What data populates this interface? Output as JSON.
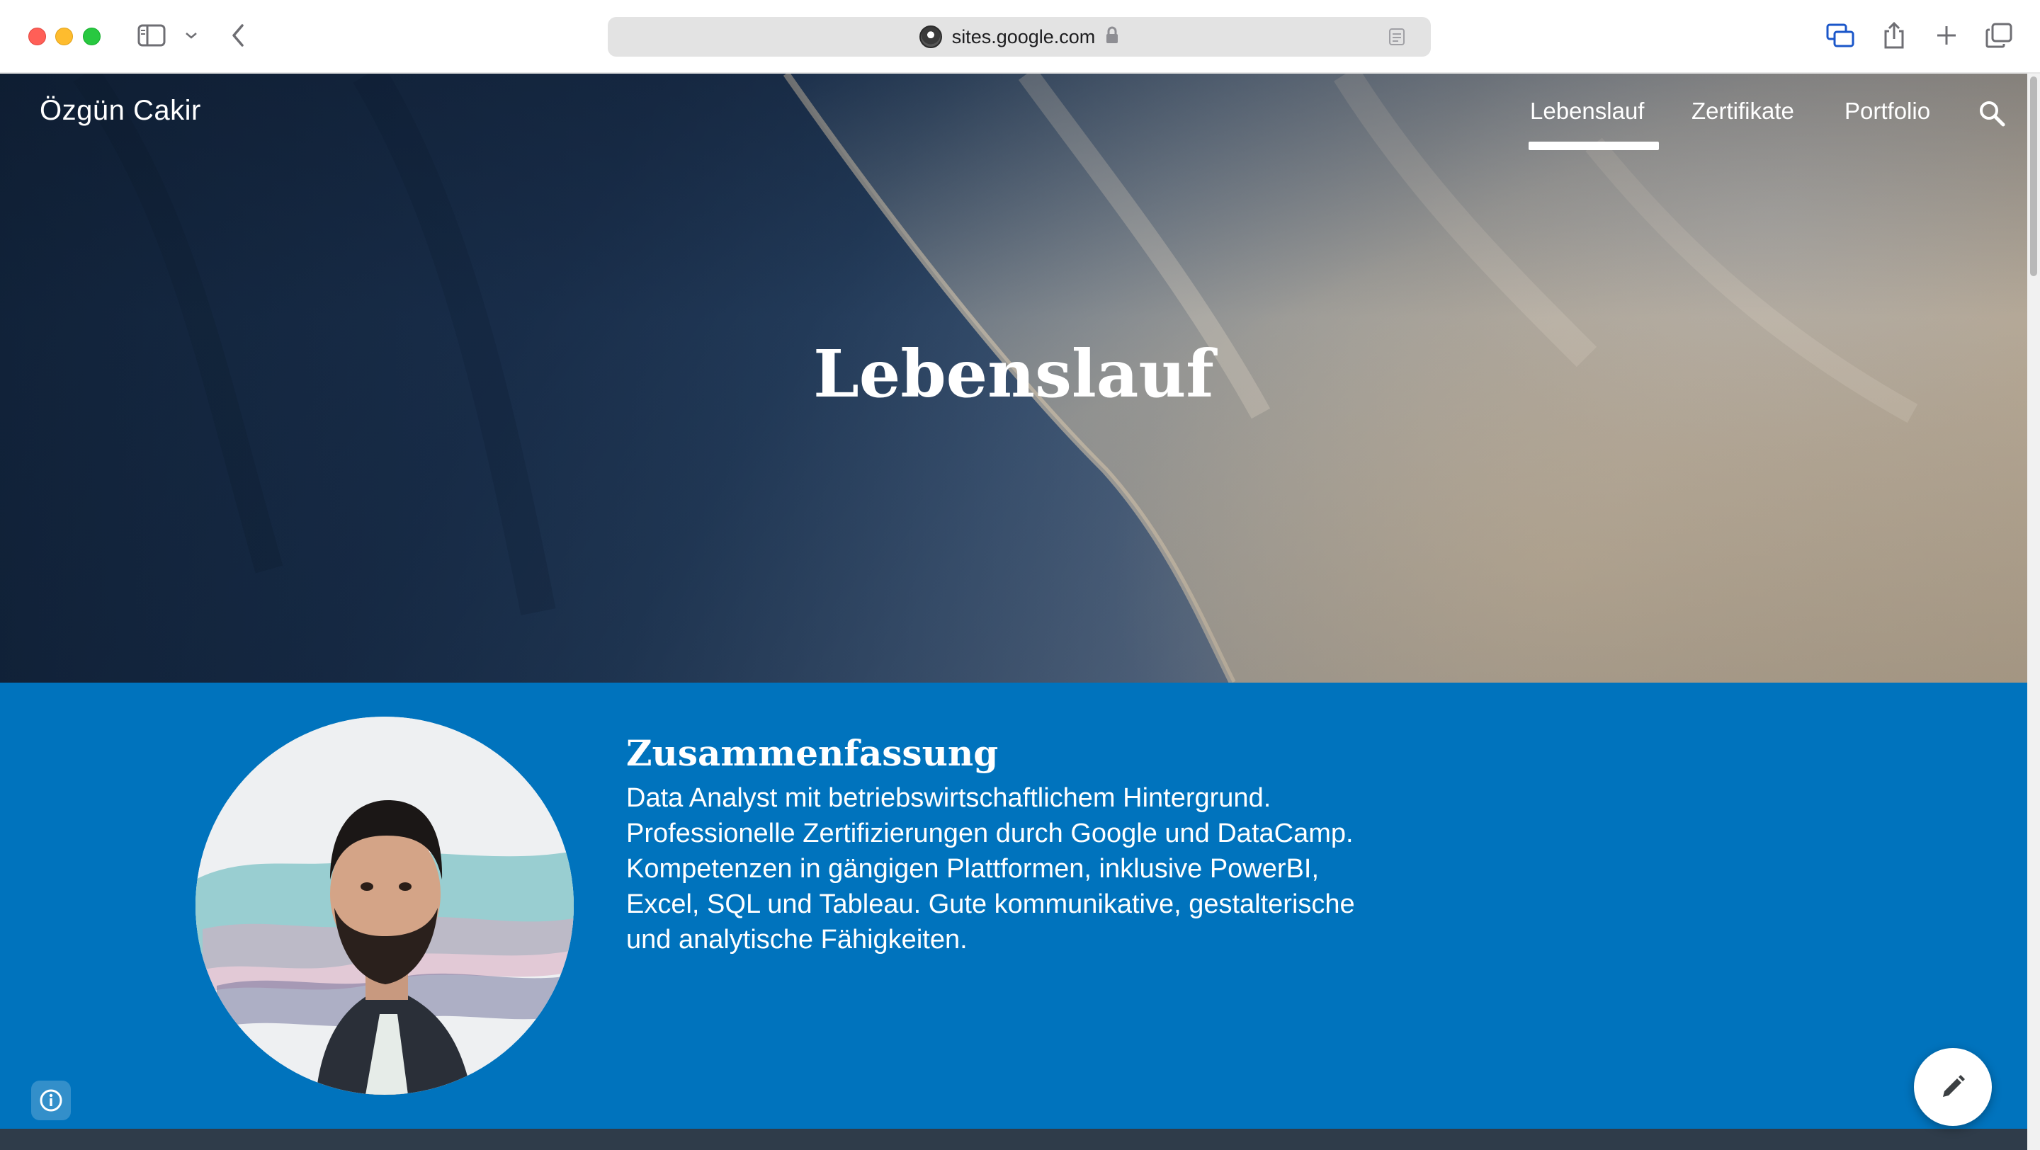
{
  "browser": {
    "url": "sites.google.com",
    "icons": [
      "sidebar-icon",
      "chevron-down-icon",
      "back-icon",
      "lock-icon",
      "reader-icon",
      "tab-overview-icon",
      "share-icon",
      "plus-icon",
      "tabs-icon"
    ]
  },
  "site": {
    "name": "Özgün Cakir",
    "nav": [
      {
        "label": "Lebenslauf",
        "active": true
      },
      {
        "label": "Zertifikate",
        "active": false
      },
      {
        "label": "Portfolio",
        "active": false
      }
    ]
  },
  "hero": {
    "title": "Lebenslauf"
  },
  "summary": {
    "heading": "Zusammenfassung",
    "text": "Data Analyst mit betriebswirtschaftlichem Hintergrund. Professionelle Zertifizierungen durch Google und DataCamp. Kompetenzen in gängigen Plattformen, inklusive PowerBI, Excel, SQL und Tableau. Gute kommunikative, gestalterische und analytische Fähigkeiten."
  },
  "colors": {
    "summary_bg": "#0073bd",
    "accent_underline": "#ffffff"
  }
}
